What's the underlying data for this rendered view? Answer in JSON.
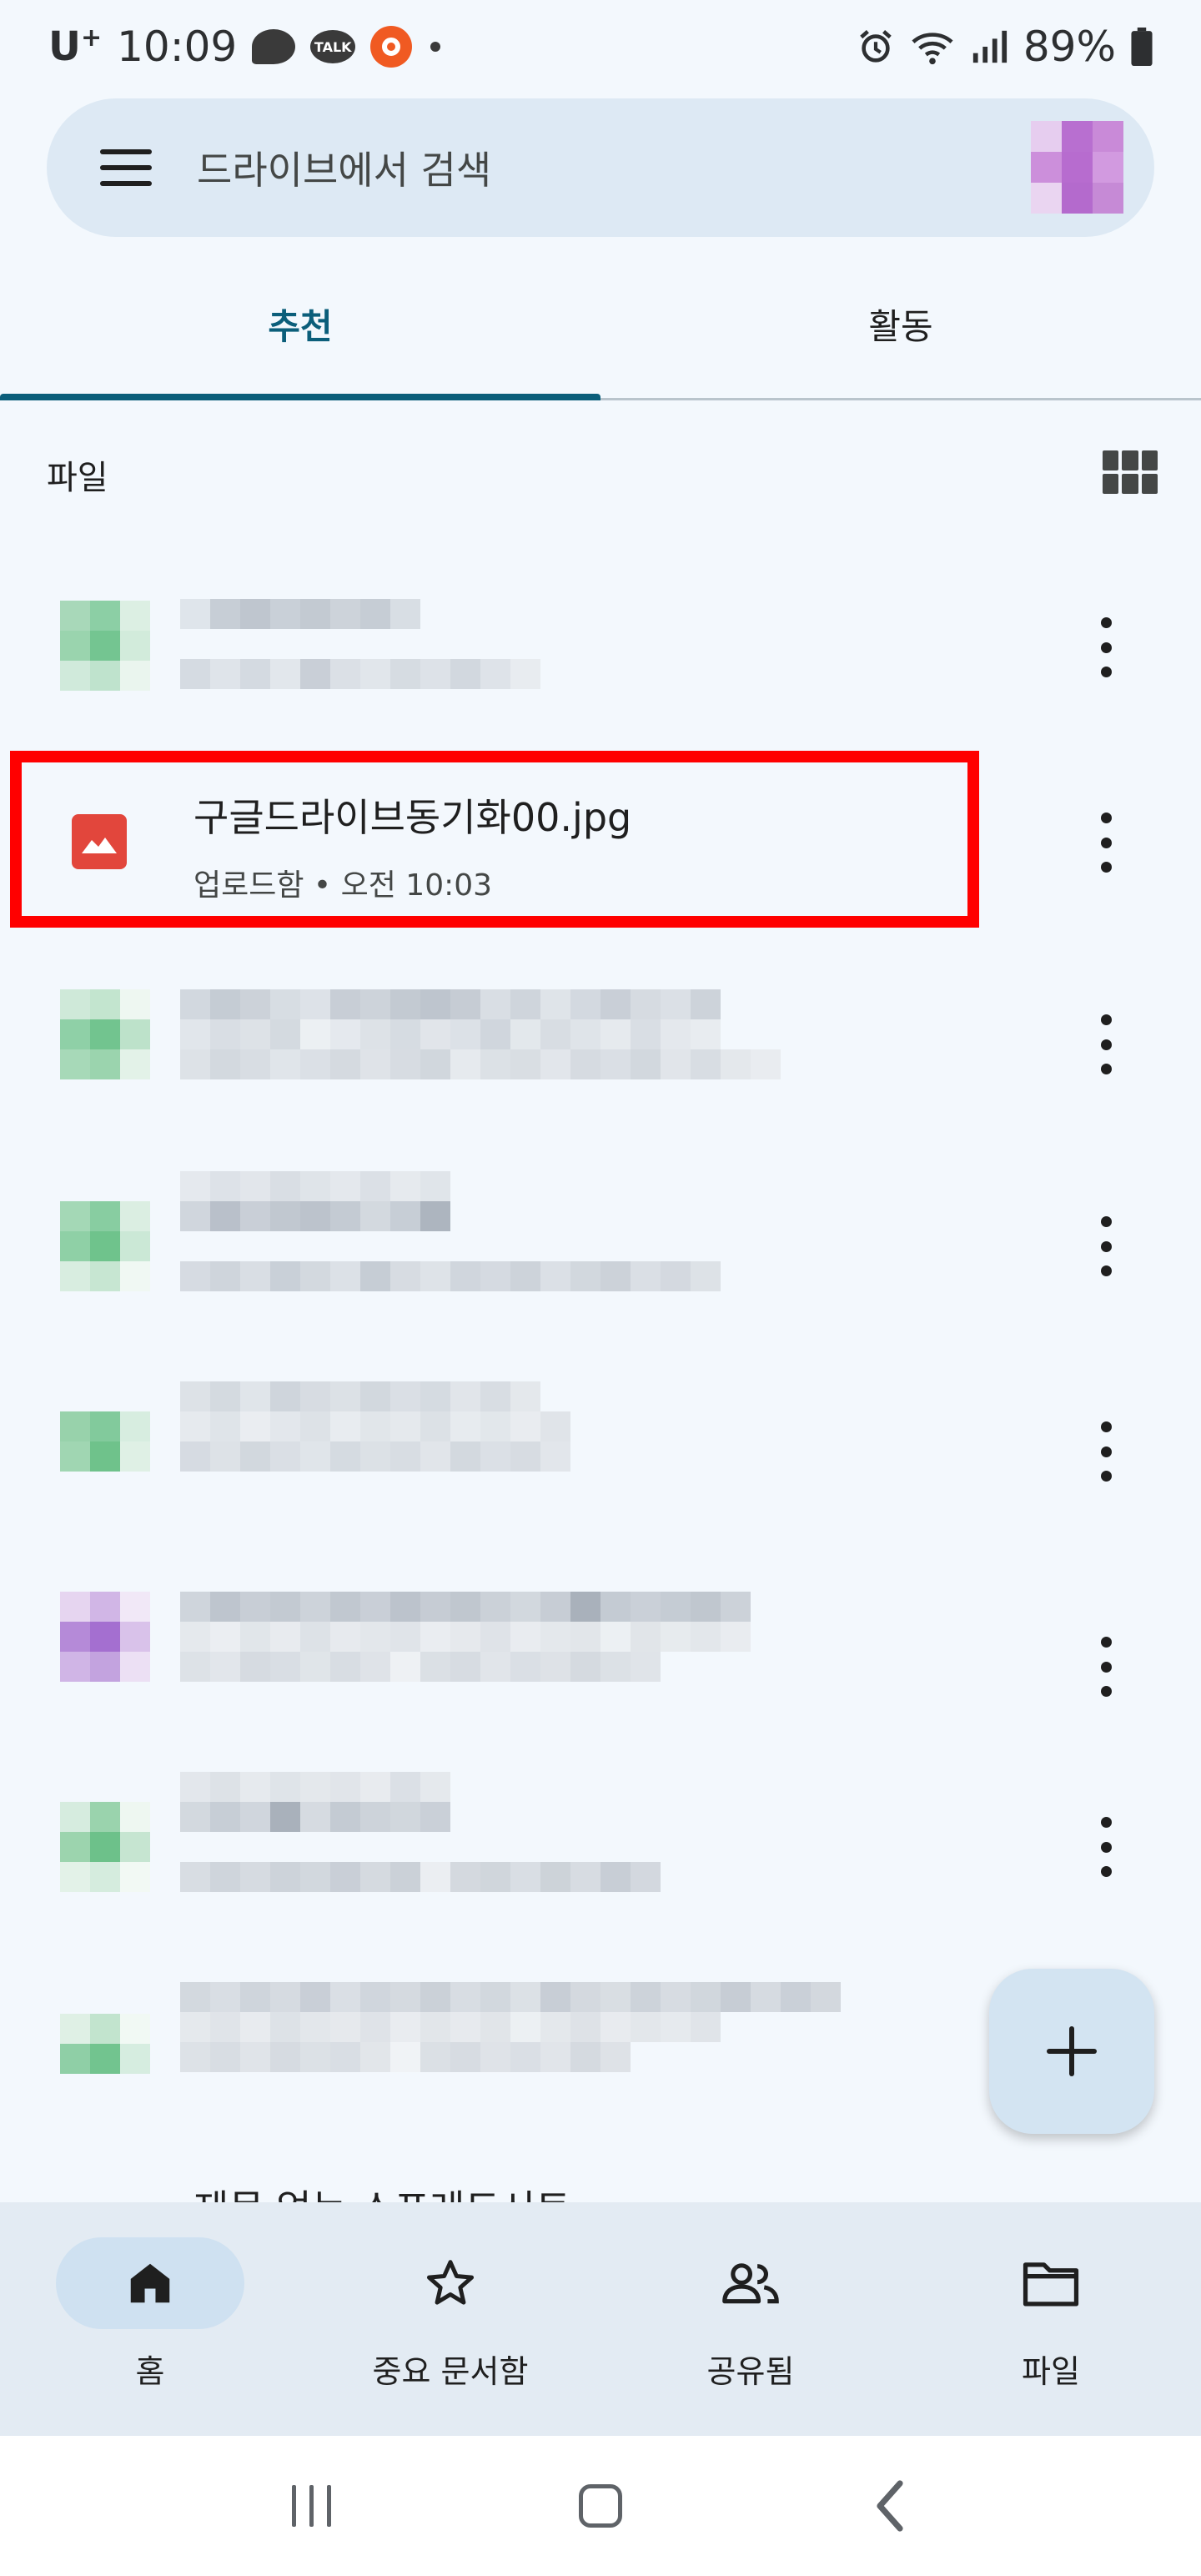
{
  "status_bar": {
    "carrier": "U",
    "carrier_sup": "+",
    "time": "10:09",
    "talk_label": "TALK",
    "battery": "89%",
    "icons": [
      "chat-bubble-icon",
      "kakaotalk-icon",
      "orange-app-icon",
      "notification-dot-icon",
      "alarm-icon",
      "wifi-icon",
      "signal-icon",
      "battery-icon"
    ]
  },
  "search": {
    "placeholder": "드라이브에서 검색"
  },
  "tabs": [
    {
      "label": "추천",
      "active": true
    },
    {
      "label": "활동",
      "active": false
    }
  ],
  "section": {
    "label": "파일"
  },
  "files": {
    "highlighted": {
      "name": "구글드라이브동기화00.jpg",
      "meta": "업로드함 • 오전 10:03"
    },
    "partial_title": "제목 없는 스프레드시트"
  },
  "bottom_nav": [
    {
      "label": "홈",
      "icon": "home-icon",
      "active": true
    },
    {
      "label": "중요 문서함",
      "icon": "star-icon",
      "active": false
    },
    {
      "label": "공유됨",
      "icon": "people-icon",
      "active": false
    },
    {
      "label": "파일",
      "icon": "folder-icon",
      "active": false
    }
  ],
  "colors": {
    "accent": "#0b5e7a",
    "highlight": "#ff0000",
    "image_file": "#e2463c",
    "background": "#f3f8fd"
  }
}
